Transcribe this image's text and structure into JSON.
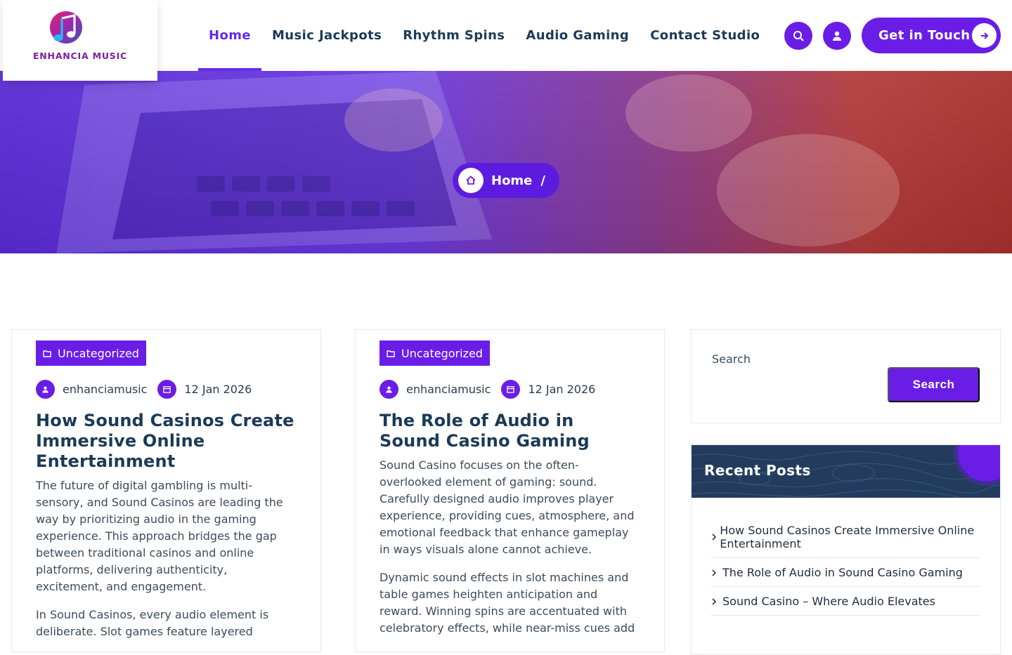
{
  "brand": {
    "name": "ENHANCIA MUSIC"
  },
  "nav": {
    "items": [
      {
        "label": "Home",
        "active": true
      },
      {
        "label": "Music Jackpots"
      },
      {
        "label": "Rhythm Spins"
      },
      {
        "label": "Audio Gaming"
      },
      {
        "label": "Contact Studio"
      }
    ]
  },
  "header": {
    "search_icon": "search-icon",
    "cart_icon": "user-icon",
    "cta_label": "Get in Touch",
    "cta_icon": "arrow-right-icon"
  },
  "hero": {
    "breadcrumb": "Home",
    "separator": "/"
  },
  "posts": [
    {
      "category": "Uncategorized",
      "author": "enhanciamusic",
      "date": "12 Jan 2026",
      "title": "How Sound Casinos Create Immersive Online Entertainment",
      "paragraphs": [
        "The future of digital gambling is multi-sensory, and Sound Casinos are leading the way by prioritizing audio in the gaming experience. This approach bridges the gap between traditional casinos and online platforms, delivering authenticity, excitement, and engagement.",
        "In Sound Casinos, every audio element is deliberate. Slot games feature layered"
      ]
    },
    {
      "category": "Uncategorized",
      "author": "enhanciamusic",
      "date": "12 Jan 2026",
      "title": "The Role of Audio in Sound Casino Gaming",
      "paragraphs": [
        "Sound Casino focuses on the often-overlooked element of gaming: sound. Carefully designed audio improves player experience, providing cues, atmosphere, and emotional feedback that enhance gameplay in ways visuals alone cannot achieve.",
        "Dynamic sound effects in slot machines and table games heighten anticipation and reward. Winning spins are accentuated with celebratory effects, while near-miss cues add"
      ]
    }
  ],
  "sidebar": {
    "search": {
      "label": "Search",
      "placeholder": "",
      "button": "Search"
    },
    "recent": {
      "title": "Recent Posts",
      "items": [
        "How Sound Casinos Create Immersive Online Entertainment",
        "The Role of Audio in Sound Casino Gaming",
        "Sound Casino – Where Audio Elevates"
      ]
    }
  },
  "colors": {
    "accent": "#6a1de6",
    "heading": "#1b3a57",
    "widget_head": "#233c5e"
  }
}
